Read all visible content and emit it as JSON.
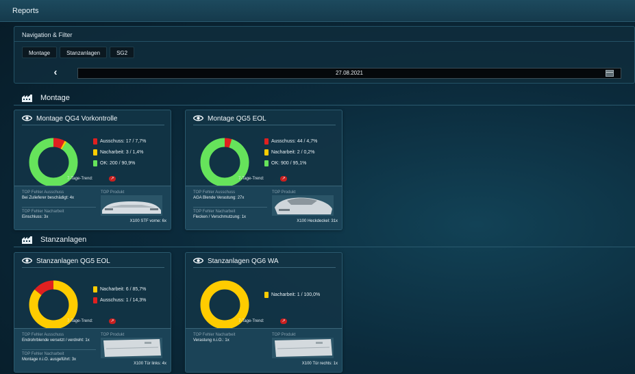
{
  "app": {
    "title": "Reports"
  },
  "filter": {
    "title": "Navigation & Filter",
    "chips": [
      "Montage",
      "Stanzanlagen",
      "SG2"
    ],
    "back_icon": "chevron-left-icon",
    "date": "27.08.2021",
    "calendar_icon": "calendar-icon"
  },
  "colors": {
    "red": "#e02020",
    "yellow": "#ffcc00",
    "green": "#66e35b"
  },
  "sections": [
    {
      "title": "Montage",
      "icon": "factory-icon",
      "cards": [
        {
          "title": "Montage QG4 Vorkontrolle",
          "icon": "eye-icon",
          "legend": [
            {
              "label": "Ausschuss: 17 / 7,7%",
              "color": "#e02020",
              "value": 17
            },
            {
              "label": "Nacharbeit: 3 / 1,4%",
              "color": "#ffcc00",
              "value": 3
            },
            {
              "label": "OK: 200 / 90,9%",
              "color": "#66e35b",
              "value": 200
            }
          ],
          "trend_label": "7-Tage-Trend:",
          "trend_icon": "trend-up-icon",
          "top_ausschuss_label": "TOP Fehler Ausschuss",
          "top_ausschuss_value": "Bei Zulieferer beschädigt: 4x",
          "top_nacharbeit_label": "TOP Fehler Nacharbeit",
          "top_nacharbeit_value": "Einschluss: 3x",
          "top_produkt_label": "TOP Produkt",
          "product_caption": "X100 STF vorne: 6x",
          "product_icon": "car-front-image"
        },
        {
          "title": "Montage QG5 EOL",
          "icon": "eye-icon",
          "legend": [
            {
              "label": "Ausschuss: 44 / 4,7%",
              "color": "#e02020",
              "value": 44
            },
            {
              "label": "Nacharbeit: 2 / 0,2%",
              "color": "#ffcc00",
              "value": 2
            },
            {
              "label": "OK: 900 / 95,1%",
              "color": "#66e35b",
              "value": 900
            }
          ],
          "trend_label": "7-Tage-Trend:",
          "trend_icon": "trend-up-icon",
          "top_ausschuss_label": "TOP Fehler Ausschuss",
          "top_ausschuss_value": "AGA Blende Verastung: 27x",
          "top_nacharbeit_label": "TOP Fehler Nacharbeit",
          "top_nacharbeit_value": "Flecken / Verschmutzung: 1x",
          "top_produkt_label": "TOP Produkt",
          "product_caption": "X100 Heckdeckel: 31x",
          "product_icon": "car-rear-image"
        }
      ]
    },
    {
      "title": "Stanzanlagen",
      "icon": "factory-icon",
      "cards": [
        {
          "title": "Stanzanlagen QG5 EOL",
          "icon": "eye-icon",
          "legend": [
            {
              "label": "Nacharbeit: 6 / 85,7%",
              "color": "#ffcc00",
              "value": 6
            },
            {
              "label": "Ausschuss: 1 / 14,3%",
              "color": "#e02020",
              "value": 1
            }
          ],
          "trend_label": "7-Tage-Trend:",
          "trend_icon": "trend-up-icon",
          "top_ausschuss_label": "TOP Fehler Ausschuss",
          "top_ausschuss_value": "Endrohrblende versetzt / verdreht: 1x",
          "top_nacharbeit_label": "TOP Fehler Nacharbeit",
          "top_nacharbeit_value": "Montage n.i.O. ausgeführt: 3x",
          "top_produkt_label": "TOP Produkt",
          "product_caption": "X100 Tür links: 4x",
          "product_icon": "car-door-image"
        },
        {
          "title": "Stanzanlagen QG6 WA",
          "icon": "eye-icon",
          "legend": [
            {
              "label": "Nacharbeit: 1 / 100,0%",
              "color": "#ffcc00",
              "value": 1
            }
          ],
          "trend_label": "7-Tage-Trend:",
          "trend_icon": "trend-up-icon",
          "top_ausschuss_label": "",
          "top_ausschuss_value": "",
          "top_nacharbeit_label": "TOP Fehler Nacharbeit",
          "top_nacharbeit_value": "Verastung n.i.O.: 1x",
          "top_produkt_label": "TOP Produkt",
          "product_caption": "X100 Tür rechts: 1x",
          "product_icon": "car-door-image"
        }
      ]
    }
  ]
}
